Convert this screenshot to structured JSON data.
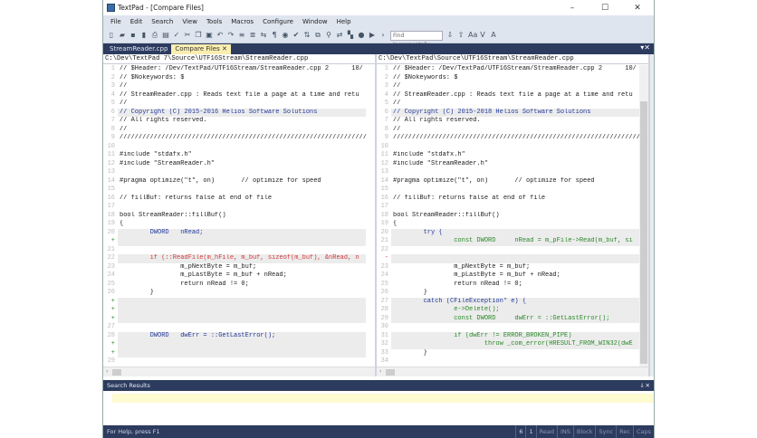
{
  "title": "TextPad - [Compare Files]",
  "window_buttons": {
    "minimize": "–",
    "maximize": "☐",
    "close": "✕"
  },
  "menu": [
    "File",
    "Edit",
    "Search",
    "View",
    "Tools",
    "Macros",
    "Configure",
    "Window",
    "Help"
  ],
  "toolbar": {
    "icons": [
      "new-file-icon",
      "open-icon",
      "save-icon",
      "save-all-icon",
      "print-icon",
      "print-preview-icon",
      "spell-icon",
      "cut-icon",
      "copy-icon",
      "paste-icon",
      "undo-icon",
      "redo-icon",
      "indent-icon",
      "outdent-icon",
      "wrap-icon",
      "pilcrow-icon",
      "sync-icon",
      "check-icon",
      "sort-icon",
      "compare-icon",
      "find-icon",
      "replace-icon",
      "binoculars-icon",
      "record-icon",
      "play-icon",
      "next-icon"
    ],
    "find_placeholder": "Find Incrementally",
    "find_buttons": [
      "⇩",
      "⇧",
      "Aa",
      "V",
      "A"
    ]
  },
  "tabs": [
    "StreamReader.cpp",
    "Compare Files ✕"
  ],
  "left": {
    "path": "C:\\Dev\\TextPad 7\\Source\\UTF16Stream\\StreamReader.cpp",
    "rows": [
      [
        "1",
        "// $Header: /Dev/TextPad/UTF16Stream/StreamReader.cpp 2      10/",
        ""
      ],
      [
        "2",
        "// $Nokeywords: $",
        ""
      ],
      [
        "3",
        "//",
        ""
      ],
      [
        "4",
        "// StreamReader.cpp : Reads text file a page at a time and retu",
        ""
      ],
      [
        "5",
        "//",
        ""
      ],
      [
        "6",
        "// Copyright (C) 2015-2016 Helios Software Solutions",
        "g blue"
      ],
      [
        "7",
        "// All rights reserved.",
        ""
      ],
      [
        "8",
        "//",
        ""
      ],
      [
        "9",
        "/////////////////////////////////////////////////////////////////",
        ""
      ],
      [
        "10",
        "",
        ""
      ],
      [
        "11",
        "#include \"stdafx.h\"",
        ""
      ],
      [
        "12",
        "#include \"StreamReader.h\"",
        ""
      ],
      [
        "13",
        "",
        ""
      ],
      [
        "14",
        "#pragma optimize(\"t\", on)       // optimize for speed",
        ""
      ],
      [
        "15",
        "",
        ""
      ],
      [
        "16",
        "// fillBuf: returns false at end of file",
        ""
      ],
      [
        "17",
        "",
        ""
      ],
      [
        "18",
        "bool StreamReader::fillBuf()",
        ""
      ],
      [
        "19",
        "{",
        ""
      ],
      [
        "20",
        "        DWORD   nRead;",
        "g blue"
      ],
      [
        "+",
        "",
        "g"
      ],
      [
        "21",
        "",
        ""
      ],
      [
        "22",
        "        if (::ReadFile(m_hFile, m_buf, sizeof(m_buf), &nRead, n",
        "g red"
      ],
      [
        "23",
        "                m_pNextByte = m_buf;",
        ""
      ],
      [
        "24",
        "                m_pLastByte = m_buf + nRead;",
        ""
      ],
      [
        "25",
        "                return nRead != 0;",
        ""
      ],
      [
        "26",
        "        }",
        ""
      ],
      [
        "+",
        "",
        "g"
      ],
      [
        "+",
        "",
        "g"
      ],
      [
        "+",
        "",
        "g"
      ],
      [
        "27",
        "",
        ""
      ],
      [
        "28",
        "        DWORD   dwErr = ::GetLastError();",
        "g blue"
      ],
      [
        "+",
        "",
        "g"
      ],
      [
        "+",
        "",
        "g"
      ],
      [
        "29",
        "",
        ""
      ],
      [
        "",
        "        .  .  .      .                    .",
        ""
      ]
    ]
  },
  "right": {
    "path": "C:\\Dev\\TextPad\\Source\\UTF16Stream\\StreamReader.cpp",
    "rows": [
      [
        "1",
        "// $Header: /Dev/TextPad/UTF16Stream/StreamReader.cpp 2      10/",
        ""
      ],
      [
        "2",
        "// $Nokeywords: $",
        ""
      ],
      [
        "3",
        "//",
        ""
      ],
      [
        "4",
        "// StreamReader.cpp : Reads text file a page at a time and retu",
        ""
      ],
      [
        "5",
        "//",
        ""
      ],
      [
        "6",
        "// Copyright (C) 2015-2018 Helios Software Solutions",
        "g blue"
      ],
      [
        "7",
        "// All rights reserved.",
        ""
      ],
      [
        "8",
        "//",
        ""
      ],
      [
        "9",
        "/////////////////////////////////////////////////////////////////",
        ""
      ],
      [
        "10",
        "",
        ""
      ],
      [
        "11",
        "#include \"stdafx.h\"",
        ""
      ],
      [
        "12",
        "#include \"StreamReader.h\"",
        ""
      ],
      [
        "13",
        "",
        ""
      ],
      [
        "14",
        "#pragma optimize(\"t\", on)       // optimize for speed",
        ""
      ],
      [
        "15",
        "",
        ""
      ],
      [
        "16",
        "// fillBuf: returns false at end of file",
        ""
      ],
      [
        "17",
        "",
        ""
      ],
      [
        "18",
        "bool StreamReader::fillBuf()",
        ""
      ],
      [
        "19",
        "{",
        ""
      ],
      [
        "20",
        "        try {",
        "g blue"
      ],
      [
        "21",
        "                const DWORD     nRead = m_pFile->Read(m_buf, si",
        "g green"
      ],
      [
        "22",
        "",
        ""
      ],
      [
        "-",
        "",
        "g"
      ],
      [
        "23",
        "                m_pNextByte = m_buf;",
        ""
      ],
      [
        "24",
        "                m_pLastByte = m_buf + nRead;",
        ""
      ],
      [
        "25",
        "                return nRead != 0;",
        ""
      ],
      [
        "26",
        "        }",
        ""
      ],
      [
        "27",
        "        catch (CFileException* e) {",
        "g blue"
      ],
      [
        "28",
        "                e->Delete();",
        "g green"
      ],
      [
        "29",
        "                const DWORD     dwErr = ::GetLastError();",
        "g green"
      ],
      [
        "30",
        "",
        ""
      ],
      [
        "31",
        "                if (dwErr != ERROR_BROKEN_PIPE)",
        "g green"
      ],
      [
        "32",
        "                        throw _com_error(HRESULT_FROM_WIN32(dwE",
        "g green"
      ],
      [
        "33",
        "        }",
        ""
      ],
      [
        "34",
        "",
        ""
      ]
    ]
  },
  "search_results": {
    "title": "Search Results",
    "buttons": "⫰ ✕"
  },
  "status": {
    "help": "For Help, press F1",
    "line": "6",
    "col": "1",
    "cells": [
      "Read",
      "INS",
      "Block",
      "Sync",
      "Rec",
      "Caps"
    ]
  }
}
